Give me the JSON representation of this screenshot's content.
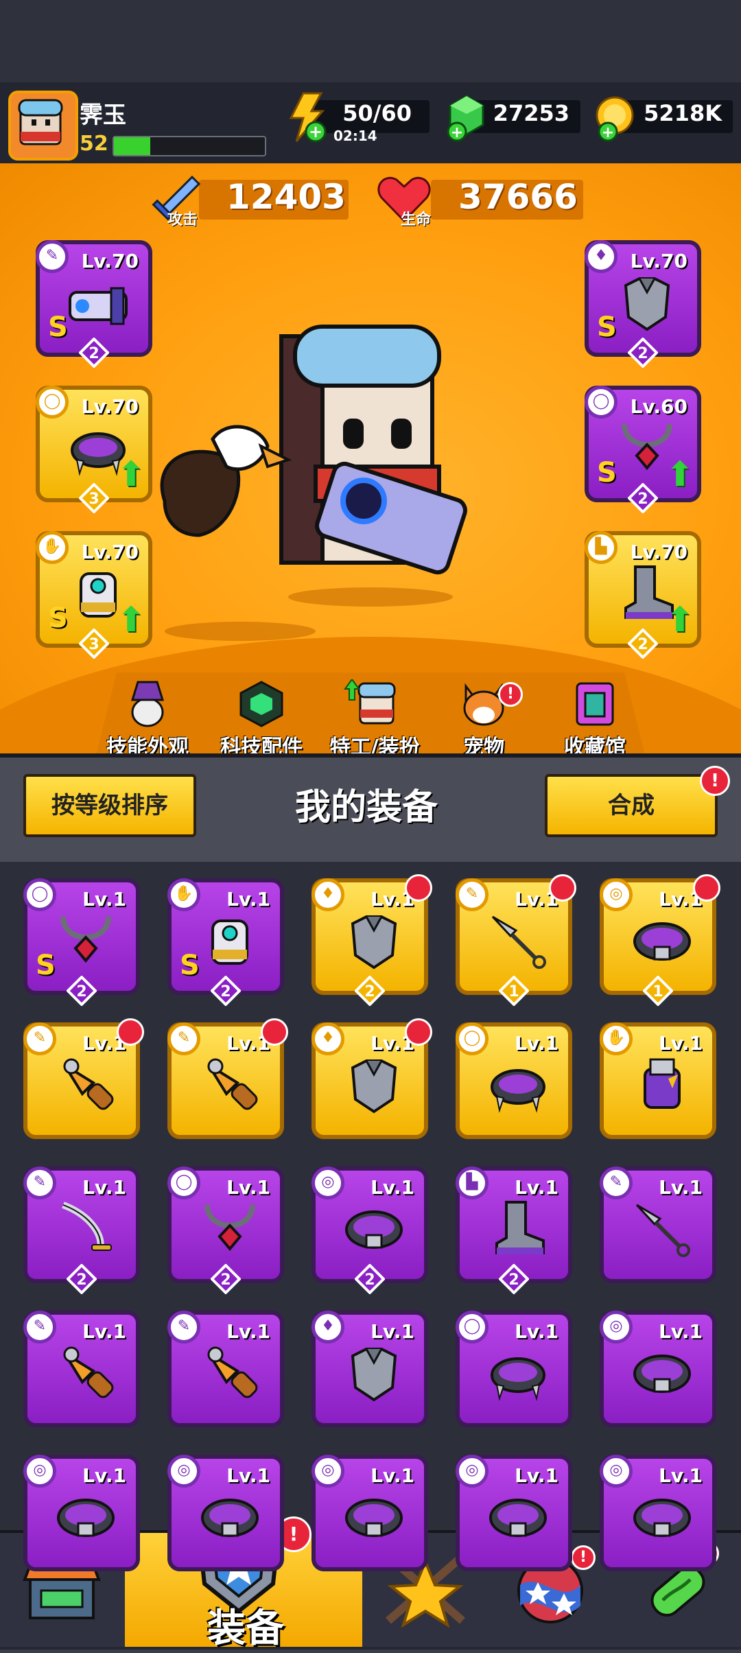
{
  "player": {
    "name": "霁玉",
    "level": "52",
    "xp_fraction": 0.24
  },
  "resources": {
    "energy": "50/60",
    "energy_timer": "02:14",
    "gems": "27253",
    "coins": "5218K"
  },
  "stats": {
    "attack_label": "攻击",
    "attack_value": "12403",
    "hp_label": "生命",
    "hp_value": "37666"
  },
  "equipped": {
    "weapon": {
      "level": "Lv.70",
      "rank": "S",
      "stars": "2"
    },
    "armor": {
      "level": "Lv.70",
      "rank": "S",
      "stars": "2"
    },
    "necklace": {
      "level": "Lv.70",
      "stars": "3"
    },
    "belt": {
      "level": "Lv.60",
      "rank": "S",
      "stars": "2"
    },
    "gloves": {
      "level": "Lv.70",
      "rank": "S",
      "stars": "3"
    },
    "boots": {
      "level": "Lv.70",
      "stars": "2"
    }
  },
  "nav": {
    "skills": "技能外观",
    "tech": "科技配件",
    "agent": "特工/装扮",
    "pet": "宠物",
    "collection": "收藏馆",
    "pet_badge": "!"
  },
  "panel": {
    "sort_button": "按等级排序",
    "title": "我的装备",
    "merge_button": "合成",
    "merge_badge": "!"
  },
  "inventory": [
    {
      "level": "Lv.1",
      "rarity": "purple",
      "rank": "S",
      "stars": "2",
      "item": "necklace"
    },
    {
      "level": "Lv.1",
      "rarity": "purple",
      "rank": "S",
      "stars": "2",
      "item": "gloves"
    },
    {
      "level": "Lv.1",
      "rarity": "yellow",
      "stars": "2",
      "item": "armor",
      "alert": true
    },
    {
      "level": "Lv.1",
      "rarity": "yellow",
      "stars": "1",
      "item": "kunai",
      "alert": true
    },
    {
      "level": "Lv.1",
      "rarity": "yellow",
      "stars": "1",
      "item": "belt",
      "alert": true
    },
    {
      "level": "Lv.1",
      "rarity": "yellow",
      "item": "drill",
      "alert": true
    },
    {
      "level": "Lv.1",
      "rarity": "yellow",
      "item": "drill",
      "alert": true
    },
    {
      "level": "Lv.1",
      "rarity": "yellow",
      "item": "armor",
      "alert": true
    },
    {
      "level": "Lv.1",
      "rarity": "yellow",
      "item": "spiked-collar"
    },
    {
      "level": "Lv.1",
      "rarity": "yellow",
      "item": "gauntlet"
    },
    {
      "level": "Lv.1",
      "rarity": "purple",
      "stars": "2",
      "item": "sword"
    },
    {
      "level": "Lv.1",
      "rarity": "purple",
      "stars": "2",
      "item": "necklace"
    },
    {
      "level": "Lv.1",
      "rarity": "purple",
      "stars": "2",
      "item": "belt"
    },
    {
      "level": "Lv.1",
      "rarity": "purple",
      "stars": "2",
      "item": "boots"
    },
    {
      "level": "Lv.1",
      "rarity": "purple",
      "item": "kunai"
    },
    {
      "level": "Lv.1",
      "rarity": "purple",
      "item": "drill"
    },
    {
      "level": "Lv.1",
      "rarity": "purple",
      "item": "drill"
    },
    {
      "level": "Lv.1",
      "rarity": "purple",
      "item": "armor"
    },
    {
      "level": "Lv.1",
      "rarity": "purple",
      "item": "spiked-collar"
    },
    {
      "level": "Lv.1",
      "rarity": "purple",
      "item": "belt"
    },
    {
      "level": "Lv.1",
      "rarity": "purple",
      "item": "belt"
    },
    {
      "level": "Lv.1",
      "rarity": "purple",
      "item": "belt"
    },
    {
      "level": "Lv.1",
      "rarity": "purple",
      "item": "belt"
    },
    {
      "level": "Lv.1",
      "rarity": "purple",
      "item": "belt"
    },
    {
      "level": "Lv.1",
      "rarity": "purple",
      "item": "belt"
    }
  ],
  "bottom_nav": {
    "shop_badge": "!",
    "equipment_label": "装备",
    "equipment_badge": "!",
    "egg_badge": "!",
    "dna_badge": "!"
  }
}
